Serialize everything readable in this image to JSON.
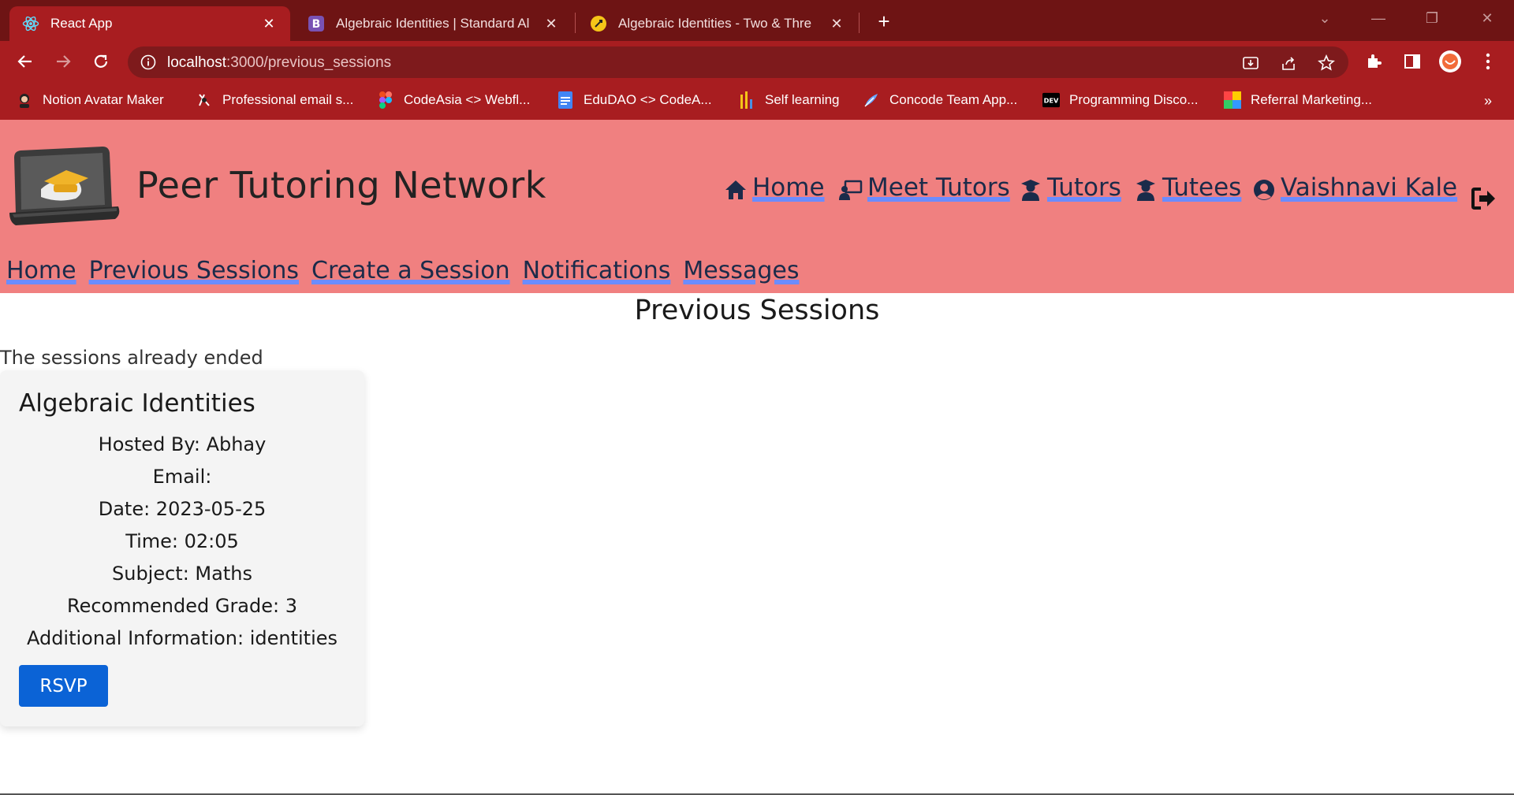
{
  "browser": {
    "tabs": [
      {
        "title": "React App",
        "icon": "react-icon",
        "active": true
      },
      {
        "title": "Algebraic Identities | Standard Al",
        "icon": "bootstrap-icon",
        "active": false
      },
      {
        "title": "Algebraic Identities - Two & Thre",
        "icon": "rocket-icon",
        "active": false
      }
    ],
    "new_tab_label": "+",
    "url_host": "localhost",
    "url_path": ":3000/previous_sessions",
    "bookmarks": [
      {
        "label": "Notion Avatar Maker",
        "icon": "avatar-icon"
      },
      {
        "label": "Professional email s...",
        "icon": "email-icon"
      },
      {
        "label": "CodeAsia <> Webfl...",
        "icon": "figma-icon"
      },
      {
        "label": "EduDAO <> CodeA...",
        "icon": "docs-icon"
      },
      {
        "label": "Self learning",
        "icon": "chart-icon"
      },
      {
        "label": "Concode Team App...",
        "icon": "feather-icon"
      },
      {
        "label": "Programming Disco...",
        "icon": "dev-icon"
      },
      {
        "label": "Referral Marketing...",
        "icon": "referral-icon"
      }
    ],
    "bookmarks_more": "»"
  },
  "header": {
    "brand": "Peer Tutoring Network",
    "nav": [
      {
        "label": "Home",
        "icon": "home-icon"
      },
      {
        "label": "Meet Tutors",
        "icon": "chalkboard-icon"
      },
      {
        "label": "Tutors",
        "icon": "graduate-icon"
      },
      {
        "label": "Tutees",
        "icon": "graduate-icon"
      },
      {
        "label": "Vaishnavi Kale",
        "icon": "user-circle-icon"
      }
    ],
    "subnav": [
      "Home",
      "Previous Sessions",
      "Create a Session",
      "Notifications",
      "Messages"
    ]
  },
  "main": {
    "title": "Previous Sessions",
    "subtitle": "The sessions already ended",
    "session": {
      "title": "Algebraic Identities",
      "hosted_by": "Hosted By: Abhay",
      "email": "Email:",
      "date": "Date: 2023-05-25",
      "time": "Time: 02:05",
      "subject": "Subject: Maths",
      "grade": "Recommended Grade: 3",
      "info": "Additional Information: identities",
      "rsvp_label": "RSVP"
    }
  },
  "colors": {
    "tabstrip": "#6e1414",
    "toolbar": "#a81d20",
    "header": "#f08080",
    "link_underline": "#6b8cff",
    "rsvp": "#0b63d6"
  }
}
